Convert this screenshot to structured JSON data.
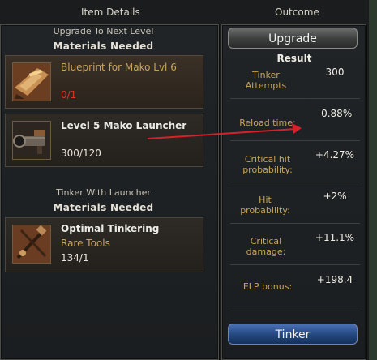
{
  "headers": {
    "left": "Item Details",
    "right": "Outcome"
  },
  "upgrade_section": {
    "subtitle": "Upgrade To Next Level",
    "materials_label": "Materials Needed",
    "items": [
      {
        "name": "Blueprint for Mako Lvl 6",
        "count": "0/1",
        "icon": "blueprint-icon"
      },
      {
        "name": "Level 5 Mako Launcher",
        "count": "300/120",
        "icon": "launcher-icon"
      }
    ]
  },
  "tinker_section": {
    "subtitle": "Tinker With Launcher",
    "materials_label": "Materials Needed",
    "item": {
      "name": "Optimal Tinkering",
      "category": "Rare Tools",
      "count": "134/1",
      "icon": "tools-icon"
    }
  },
  "outcome": {
    "upgrade_button": "Upgrade",
    "result_label": "Result",
    "stats": [
      {
        "label": "Tinker Attempts",
        "value": "300"
      },
      {
        "label": "Reload time:",
        "value": "-0.88%"
      },
      {
        "label": "Critical hit probability:",
        "value": "+4.27%"
      },
      {
        "label": "Hit probability:",
        "value": "+2%"
      },
      {
        "label": "Critical damage:",
        "value": "+11.1%"
      },
      {
        "label": "ELP bonus:",
        "value": "+198.4"
      }
    ],
    "tinker_button": "Tinker"
  },
  "colors": {
    "arrow": "#d8202a",
    "gold_text": "#c9a45a",
    "red_text": "#d63a2a",
    "tinker_button": "#23477e"
  }
}
